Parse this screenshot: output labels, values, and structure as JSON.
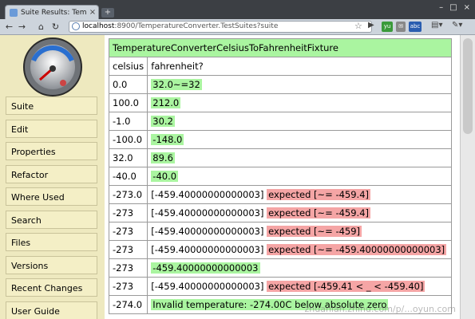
{
  "browser": {
    "tab_title": "Suite Results: Temper...",
    "url_host": "localhost",
    "url_rest": ":8900/TemperatureConverter.TestSuites?suite"
  },
  "sidebar": {
    "logo_text": "FitNesse",
    "items": [
      "Suite",
      "Edit",
      "Properties",
      "Refactor",
      "Where Used",
      "Search",
      "Files",
      "Versions",
      "Recent Changes",
      "User Guide"
    ]
  },
  "table": {
    "fixture": "TemperatureConverterCelsiusToFahrenheitFixture",
    "headers": [
      "celsius",
      "fahrenheit?"
    ],
    "rows": [
      {
        "celsius": "0.0",
        "actual": "32.0~=32",
        "expected": "",
        "status": "pass"
      },
      {
        "celsius": "100.0",
        "actual": "212.0",
        "expected": "",
        "status": "pass"
      },
      {
        "celsius": "-1.0",
        "actual": "30.2",
        "expected": "",
        "status": "pass"
      },
      {
        "celsius": "-100.0",
        "actual": "-148.0",
        "expected": "",
        "status": "pass"
      },
      {
        "celsius": "32.0",
        "actual": "89.6",
        "expected": "",
        "status": "pass"
      },
      {
        "celsius": "-40.0",
        "actual": "-40.0",
        "expected": "",
        "status": "pass"
      },
      {
        "celsius": "-273.0",
        "actual": "[-459.40000000000003]",
        "expected": "expected [~= -459.4]",
        "status": "fail"
      },
      {
        "celsius": "-273",
        "actual": "[-459.40000000000003]",
        "expected": "expected [~= -459.4]",
        "status": "fail"
      },
      {
        "celsius": "-273",
        "actual": "[-459.40000000000003]",
        "expected": "expected [~= -459]",
        "status": "fail"
      },
      {
        "celsius": "-273",
        "actual": "[-459.40000000000003]",
        "expected": "expected [~= -459.40000000000003]",
        "status": "fail"
      },
      {
        "celsius": "-273",
        "actual": "-459.40000000000003",
        "expected": "",
        "status": "pass"
      },
      {
        "celsius": "-273",
        "actual": "[-459.40000000000003]",
        "expected": "expected [-459.41 < _ < -459.40]",
        "status": "fail"
      },
      {
        "celsius": "-274.0",
        "actual": "Invalid temperature: -274.00C below absolute zero",
        "expected": "",
        "status": "pass"
      }
    ]
  },
  "watermark": "zhuanlan.zhihu.com/p/...oyun.com",
  "colors": {
    "pass": "#aaf5a0",
    "fail": "#f5a5a5",
    "sidebar": "#eee9bf"
  }
}
